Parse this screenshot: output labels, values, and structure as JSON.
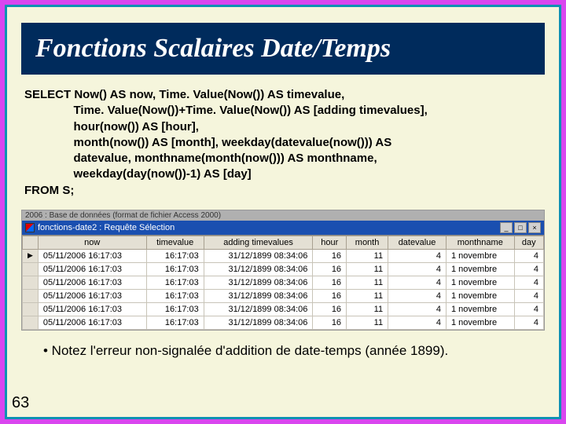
{
  "page_number": "63",
  "title": "Fonctions Scalaires Date/Temps",
  "sql_text": "SELECT Now() AS now, Time. Value(Now()) AS timevalue,\n               Time. Value(Now())+Time. Value(Now()) AS [adding timevalues],\n               hour(now()) AS [hour],\n               month(now()) AS [month], weekday(datevalue(now())) AS\n               datevalue, monthname(month(now())) AS monthname,\n               weekday(day(now())-1) AS [day]\nFROM S;",
  "outer_caption": "2006 : Base de données (format de fichier Access 2000)",
  "inner_window_title": "fonctions-date2 : Requête Sélection",
  "win_buttons": {
    "min": "_",
    "max": "□",
    "close": "×"
  },
  "columns": [
    "now",
    "timevalue",
    "adding timevalues",
    "hour",
    "month",
    "datevalue",
    "monthname",
    "day"
  ],
  "rows": [
    {
      "sel": "▶",
      "now": "05/11/2006 16:17:03",
      "timevalue": "16:17:03",
      "adding": "31/12/1899 08:34:06",
      "hour": "16",
      "month": "11",
      "datevalue": "4",
      "monthname": "1 novembre",
      "day": "4"
    },
    {
      "sel": "",
      "now": "05/11/2006 16:17:03",
      "timevalue": "16:17:03",
      "adding": "31/12/1899 08:34:06",
      "hour": "16",
      "month": "11",
      "datevalue": "4",
      "monthname": "1 novembre",
      "day": "4"
    },
    {
      "sel": "",
      "now": "05/11/2006 16:17:03",
      "timevalue": "16:17:03",
      "adding": "31/12/1899 08:34:06",
      "hour": "16",
      "month": "11",
      "datevalue": "4",
      "monthname": "1 novembre",
      "day": "4"
    },
    {
      "sel": "",
      "now": "05/11/2006 16:17:03",
      "timevalue": "16:17:03",
      "adding": "31/12/1899 08:34:06",
      "hour": "16",
      "month": "11",
      "datevalue": "4",
      "monthname": "1 novembre",
      "day": "4"
    },
    {
      "sel": "",
      "now": "05/11/2006 16:17:03",
      "timevalue": "16:17:03",
      "adding": "31/12/1899 08:34:06",
      "hour": "16",
      "month": "11",
      "datevalue": "4",
      "monthname": "1 novembre",
      "day": "4"
    },
    {
      "sel": "",
      "now": "05/11/2006 16:17:03",
      "timevalue": "16:17:03",
      "adding": "31/12/1899 08:34:06",
      "hour": "16",
      "month": "11",
      "datevalue": "4",
      "monthname": "1 novembre",
      "day": "4"
    }
  ],
  "footnote": "• Notez l'erreur non-signalée d'addition de date-temps (année 1899).",
  "chart_data": {
    "type": "table",
    "title": "fonctions-date2 : Requête Sélection",
    "columns": [
      "now",
      "timevalue",
      "adding timevalues",
      "hour",
      "month",
      "datevalue",
      "monthname",
      "day"
    ],
    "rows": [
      [
        "05/11/2006 16:17:03",
        "16:17:03",
        "31/12/1899 08:34:06",
        16,
        11,
        4,
        "1 novembre",
        4
      ],
      [
        "05/11/2006 16:17:03",
        "16:17:03",
        "31/12/1899 08:34:06",
        16,
        11,
        4,
        "1 novembre",
        4
      ],
      [
        "05/11/2006 16:17:03",
        "16:17:03",
        "31/12/1899 08:34:06",
        16,
        11,
        4,
        "1 novembre",
        4
      ],
      [
        "05/11/2006 16:17:03",
        "16:17:03",
        "31/12/1899 08:34:06",
        16,
        11,
        4,
        "1 novembre",
        4
      ],
      [
        "05/11/2006 16:17:03",
        "16:17:03",
        "31/12/1899 08:34:06",
        16,
        11,
        4,
        "1 novembre",
        4
      ],
      [
        "05/11/2006 16:17:03",
        "16:17:03",
        "31/12/1899 08:34:06",
        16,
        11,
        4,
        "1 novembre",
        4
      ]
    ]
  }
}
